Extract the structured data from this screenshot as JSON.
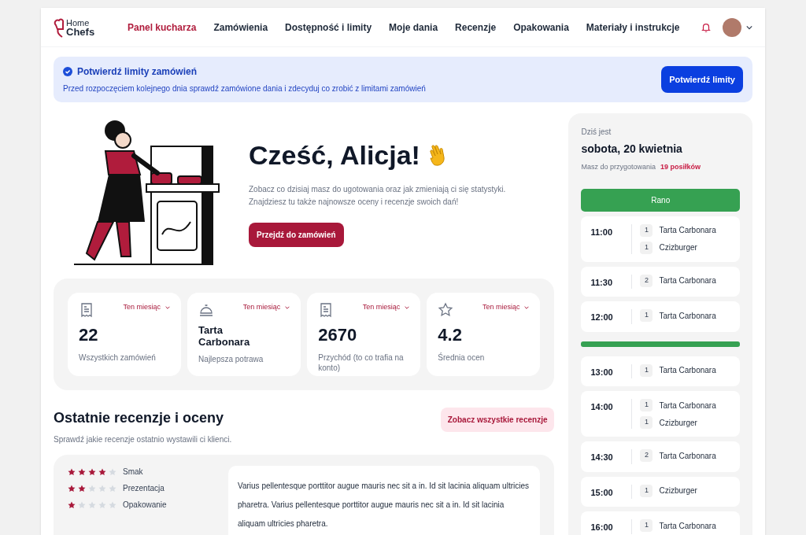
{
  "logo": {
    "line1": "Home",
    "line2": "Chefs"
  },
  "nav": [
    {
      "label": "Panel kucharza",
      "selected": true
    },
    {
      "label": "Zamówienia",
      "selected": false
    },
    {
      "label": "Dostępność i limity",
      "selected": false
    },
    {
      "label": "Moje dania",
      "selected": false
    },
    {
      "label": "Recenzje",
      "selected": false
    },
    {
      "label": "Opakowania",
      "selected": false
    },
    {
      "label": "Materiały i instrukcje",
      "selected": false
    }
  ],
  "banner": {
    "title": "Potwierdź limity zamówień",
    "text": "Przed rozpoczęciem kolejnego dnia sprawdź zamówione dania i zdecyduj co zrobić z limitami zamówień",
    "button": "Potwierdź limity"
  },
  "hero": {
    "title": "Cześć, Alicja!",
    "text": "Zobacz co dzisiaj masz do ugotowania oraz jak zmieniają ci się statystyki. Znajdziesz tu także najnowsze oceny i recenzje swoich dań!",
    "button": "Przejdź do zamówień"
  },
  "stats": [
    {
      "kind": "orders",
      "period": "Ten miesiąc",
      "value": "22",
      "label": "Wszystkich zamówień"
    },
    {
      "kind": "dish",
      "period": "Ten miesiąc",
      "value": "Tarta Carbonara",
      "label": "Najlepsza potrawa"
    },
    {
      "kind": "revenue",
      "period": "Ten miesiąc",
      "value": "2670",
      "label": "Przychód (to co trafia na konto)"
    },
    {
      "kind": "rating",
      "period": "Ten miesiąc",
      "value": "4.2",
      "label": "Średnia ocen"
    }
  ],
  "reviews": {
    "title": "Ostatnie recenzje i oceny",
    "subtitle": "Sprawdź jakie recenzje ostatnio wystawili ci klienci.",
    "button": "Zobacz wszystkie recenzje",
    "items": [
      {
        "ratings": [
          {
            "label": "Smak",
            "stars": 4
          },
          {
            "label": "Prezentacja",
            "stars": 2
          },
          {
            "label": "Opakowanie",
            "stars": 1
          }
        ],
        "text": "Varius pellentesque porttitor augue mauris nec sit a in. Id sit lacinia aliquam ultricies pharetra. Varius pellentesque porttitor augue mauris nec sit a in. Id sit lacinia aliquam ultricies pharetra."
      }
    ]
  },
  "today": {
    "caption": "Dziś jest",
    "date": "sobota, 20 kwietnia",
    "prep_label": "Masz do przygotowania",
    "prep_count": "19 posiłków",
    "groups": [
      {
        "label": "Rano",
        "slots": [
          {
            "time": "11:00",
            "items": [
              {
                "qty": "1",
                "name": "Tarta Carbonara"
              },
              {
                "qty": "1",
                "name": "Czizburger"
              }
            ]
          },
          {
            "time": "11:30",
            "items": [
              {
                "qty": "2",
                "name": "Tarta Carbonara"
              }
            ]
          },
          {
            "time": "12:00",
            "items": [
              {
                "qty": "1",
                "name": "Tarta Carbonara"
              }
            ]
          }
        ]
      },
      {
        "slots": [
          {
            "time": "13:00",
            "items": [
              {
                "qty": "1",
                "name": "Tarta Carbonara"
              }
            ]
          },
          {
            "time": "14:00",
            "items": [
              {
                "qty": "1",
                "name": "Tarta Carbonara"
              },
              {
                "qty": "1",
                "name": "Czizburger"
              }
            ]
          },
          {
            "time": "14:30",
            "items": [
              {
                "qty": "2",
                "name": "Tarta Carbonara"
              }
            ]
          },
          {
            "time": "15:00",
            "items": [
              {
                "qty": "1",
                "name": "Czizburger"
              }
            ]
          },
          {
            "time": "16:00",
            "items": [
              {
                "qty": "1",
                "name": "Tarta Carbonara"
              }
            ]
          }
        ]
      }
    ]
  }
}
